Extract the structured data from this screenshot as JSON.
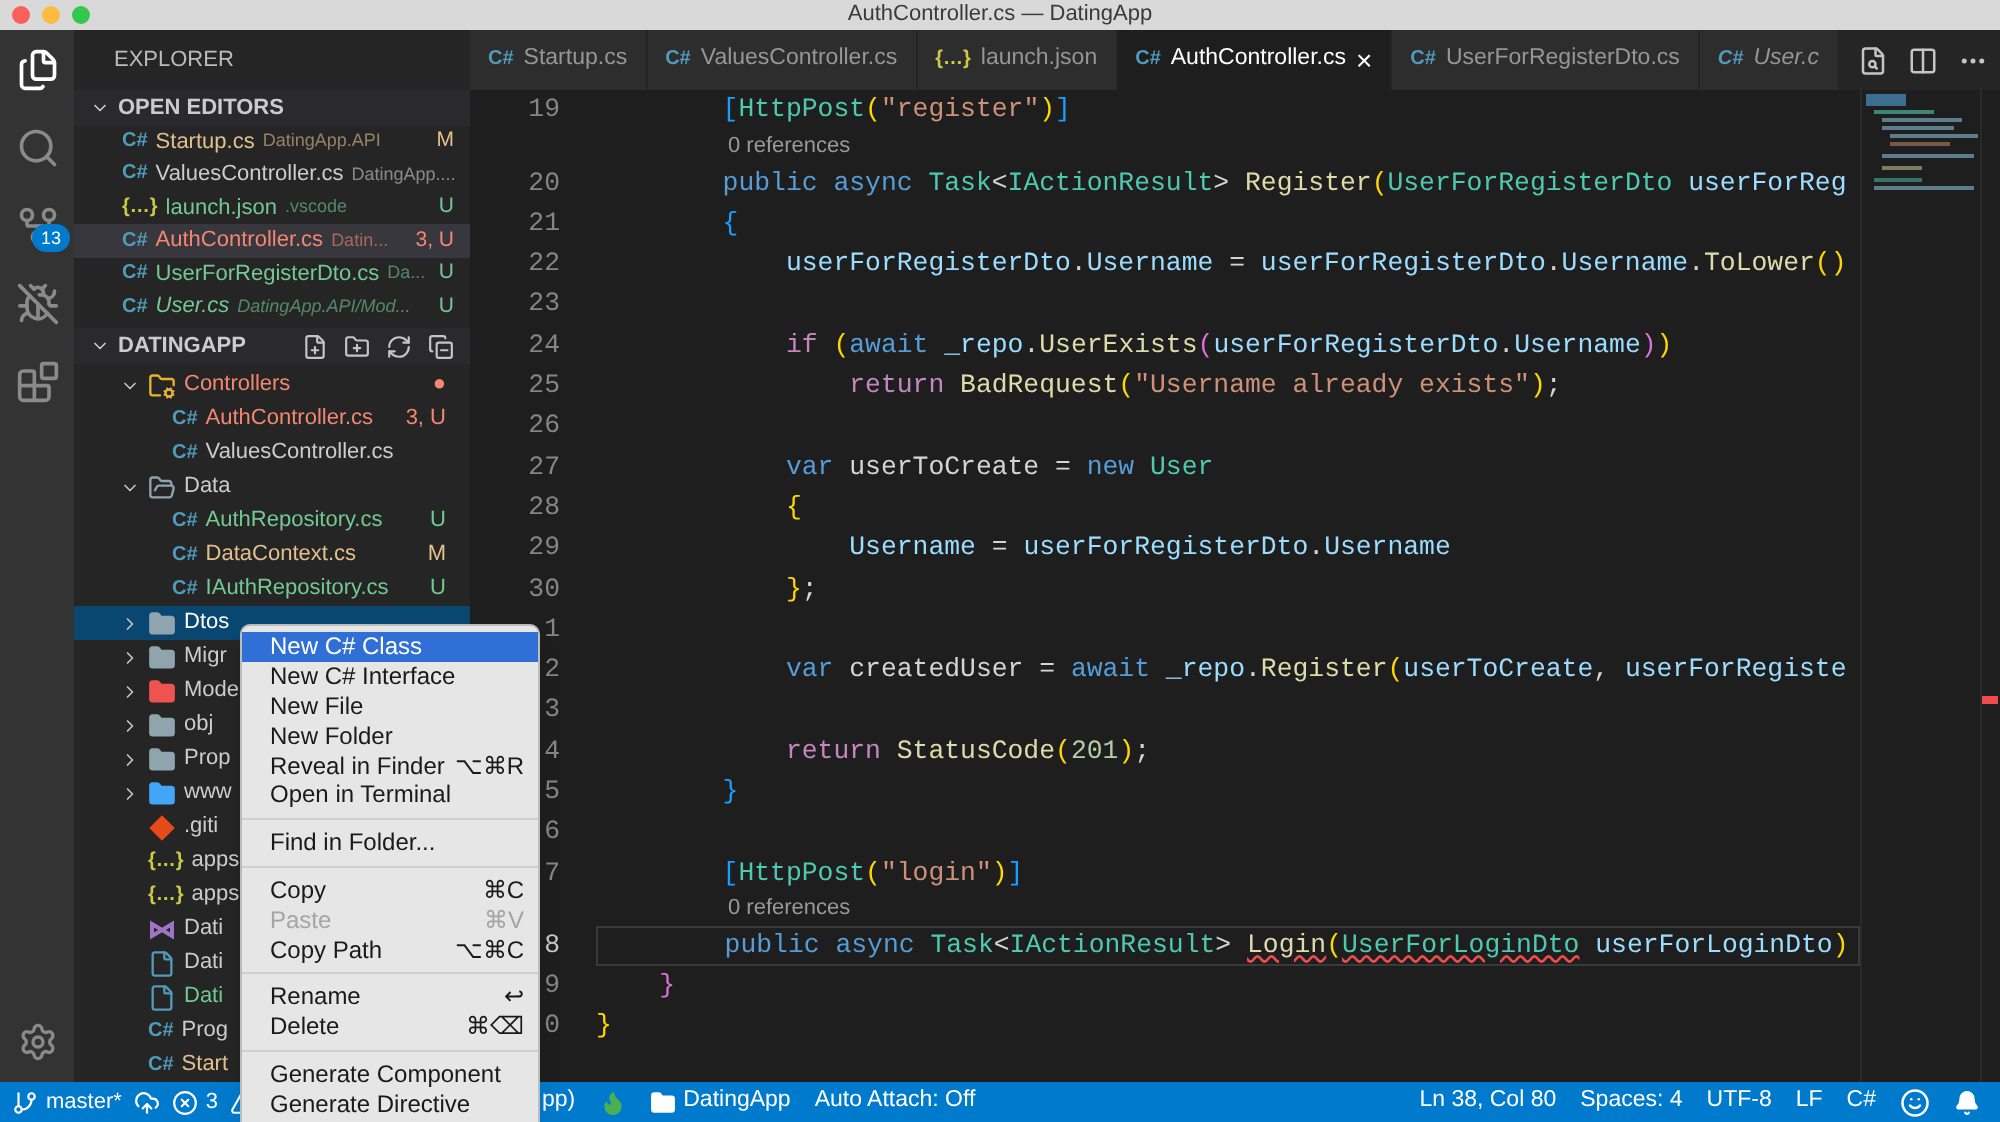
{
  "window": {
    "title": "AuthController.cs — DatingApp"
  },
  "activity_bar": {
    "items": [
      {
        "kind": "explorer",
        "selected": true
      },
      {
        "kind": "search",
        "selected": false
      },
      {
        "kind": "scm",
        "selected": false,
        "badge": "13"
      },
      {
        "kind": "debug",
        "selected": false
      },
      {
        "kind": "extensions",
        "selected": false
      }
    ]
  },
  "sidebar": {
    "title": "EXPLORER",
    "open_editors": {
      "title": "OPEN EDITORS",
      "expanded": true,
      "items": [
        {
          "name": "Startup.cs",
          "description": "DatingApp.API",
          "badge": "M",
          "kind": "csharp",
          "glyph": "C#",
          "color": "#e2c08d",
          "selected": false,
          "preview": false
        },
        {
          "name": "ValuesController.cs",
          "description": "DatingApp....",
          "kind": "csharp",
          "glyph": "C#",
          "color": "#cccccc",
          "selected": false,
          "preview": false
        },
        {
          "name": "launch.json",
          "description": ".vscode",
          "badge": "U",
          "kind": "json",
          "glyph": "{…}",
          "color": "#73c991",
          "selected": false,
          "preview": false
        },
        {
          "name": "AuthController.cs",
          "description": "Datin...",
          "badge": "3, U",
          "kind": "csharp",
          "glyph": "C#",
          "color": "#f48771",
          "selected": true,
          "preview": false
        },
        {
          "name": "UserForRegisterDto.cs",
          "description": "Da...",
          "badge": "U",
          "kind": "csharp",
          "glyph": "C#",
          "color": "#73c991",
          "selected": false,
          "preview": false
        },
        {
          "name": "User.cs",
          "description": "DatingApp.API/Mod...",
          "badge": "U",
          "kind": "csharp",
          "glyph": "C#",
          "color": "#73c991",
          "selected": false,
          "preview": true
        }
      ]
    },
    "project": {
      "title": "DATINGAPP",
      "expanded": true,
      "tree": [
        {
          "name": "Controllers",
          "kind": "folder-gear",
          "color": "#f48771",
          "badge": "●",
          "expanded": true,
          "selected": false,
          "children": [
            {
              "name": "AuthController.cs",
              "kind": "csharp",
              "glyph": "C#",
              "color": "#f48771",
              "badge": "3, U",
              "selected": false
            },
            {
              "name": "ValuesController.cs",
              "kind": "csharp",
              "glyph": "C#",
              "color": "#cccccc",
              "selected": false
            }
          ]
        },
        {
          "name": "Data",
          "kind": "folder-open",
          "color": "#cccccc",
          "expanded": true,
          "selected": false,
          "children": [
            {
              "name": "AuthRepository.cs",
              "kind": "csharp",
              "glyph": "C#",
              "color": "#73c991",
              "badge": "U",
              "selected": false
            },
            {
              "name": "DataContext.cs",
              "kind": "csharp",
              "glyph": "C#",
              "color": "#e2c08d",
              "badge": "M",
              "selected": false
            },
            {
              "name": "IAuthRepository.cs",
              "kind": "csharp",
              "glyph": "C#",
              "color": "#73c991",
              "badge": "U",
              "selected": false
            }
          ]
        },
        {
          "name": "Dtos",
          "kind": "folder",
          "expanded": false,
          "selected": true
        },
        {
          "name": "Migr",
          "kind": "folder",
          "color": "#cccccc",
          "expanded": false,
          "selected": false
        },
        {
          "name": "Mode",
          "kind": "folder-red",
          "color": "#cccccc",
          "expanded": false,
          "selected": false
        },
        {
          "name": "obj",
          "kind": "folder",
          "color": "#cccccc",
          "expanded": false,
          "selected": false
        },
        {
          "name": "Prop",
          "kind": "folder",
          "color": "#cccccc",
          "expanded": false,
          "selected": false
        },
        {
          "name": "www",
          "kind": "folder-web",
          "color": "#cccccc",
          "expanded": false,
          "selected": false
        },
        {
          "name": ".giti",
          "kind": "git",
          "color": "#cccccc",
          "selected": false
        },
        {
          "name": "apps",
          "kind": "json",
          "glyph": "{…}",
          "color": "#cccccc",
          "selected": false
        },
        {
          "name": "apps",
          "kind": "json",
          "glyph": "{…}",
          "color": "#cccccc",
          "selected": false
        },
        {
          "name": "Dati",
          "kind": "vs",
          "color": "#cccccc",
          "selected": false
        },
        {
          "name": "Dati",
          "kind": "file",
          "color": "#cccccc",
          "selected": false
        },
        {
          "name": "Dati",
          "kind": "file",
          "color": "#73c991",
          "selected": false
        },
        {
          "name": "Prog",
          "kind": "csharp",
          "glyph": "C#",
          "color": "#cccccc",
          "selected": false
        },
        {
          "name": "Start",
          "kind": "csharp",
          "glyph": "C#",
          "color": "#e2c08d",
          "selected": false
        }
      ]
    }
  },
  "tabs": [
    {
      "label": "Startup.cs",
      "kind": "csharp",
      "glyph": "C#",
      "selected": false,
      "preview": false
    },
    {
      "label": "ValuesController.cs",
      "kind": "csharp",
      "glyph": "C#",
      "selected": false,
      "preview": false
    },
    {
      "label": "launch.json",
      "kind": "json",
      "glyph": "{…}",
      "selected": false,
      "preview": false
    },
    {
      "label": "AuthController.cs",
      "kind": "csharp",
      "glyph": "C#",
      "selected": true,
      "preview": false,
      "close": "×"
    },
    {
      "label": "UserForRegisterDto.cs",
      "kind": "csharp",
      "glyph": "C#",
      "selected": false,
      "preview": false
    },
    {
      "label": "User.c",
      "kind": "csharp",
      "glyph": "C#",
      "selected": false,
      "preview": true
    }
  ],
  "editor": {
    "lines": [
      {
        "kind": "code",
        "number": "19",
        "current": false,
        "tokens": [
          {
            "text": "        [",
            "kind": "b3"
          },
          {
            "text": "HttpPost",
            "kind": "type"
          },
          {
            "text": "(",
            "kind": "b1"
          },
          {
            "text": "\"register\"",
            "kind": "str"
          },
          {
            "text": ")",
            "kind": "b1"
          },
          {
            "text": "]",
            "kind": "b3"
          }
        ]
      },
      {
        "kind": "codelens",
        "text": "0 references"
      },
      {
        "kind": "code",
        "number": "20",
        "current": false,
        "tokens": [
          {
            "text": "        public async ",
            "kind": "kw"
          },
          {
            "text": "Task",
            "kind": "type"
          },
          {
            "text": "<",
            "kind": "p"
          },
          {
            "text": "IActionResult",
            "kind": "type"
          },
          {
            "text": "> ",
            "kind": "p"
          },
          {
            "text": "Register",
            "kind": "fn"
          },
          {
            "text": "(",
            "kind": "b1"
          },
          {
            "text": "UserForRegisterDto ",
            "kind": "type"
          },
          {
            "text": "userForReg",
            "kind": "var"
          }
        ]
      },
      {
        "kind": "code",
        "number": "21",
        "current": false,
        "tokens": [
          {
            "text": "        {",
            "kind": "b3"
          }
        ]
      },
      {
        "kind": "code",
        "number": "22",
        "current": false,
        "tokens": [
          {
            "text": "            userForRegisterDto",
            "kind": "var"
          },
          {
            "text": ".",
            "kind": "p"
          },
          {
            "text": "Username",
            "kind": "var"
          },
          {
            "text": " = ",
            "kind": "p"
          },
          {
            "text": "userForRegisterDto",
            "kind": "var"
          },
          {
            "text": ".",
            "kind": "p"
          },
          {
            "text": "Username",
            "kind": "var"
          },
          {
            "text": ".",
            "kind": "p"
          },
          {
            "text": "ToLower",
            "kind": "fn"
          },
          {
            "text": "()",
            "kind": "b1"
          }
        ]
      },
      {
        "kind": "code",
        "number": "23",
        "current": false
      },
      {
        "kind": "code",
        "number": "24",
        "current": false,
        "tokens": [
          {
            "text": "            if ",
            "kind": "ctl"
          },
          {
            "text": "(",
            "kind": "b1"
          },
          {
            "text": "await ",
            "kind": "kw"
          },
          {
            "text": "_repo",
            "kind": "var"
          },
          {
            "text": ".",
            "kind": "p"
          },
          {
            "text": "UserExists",
            "kind": "fn"
          },
          {
            "text": "(",
            "kind": "b2"
          },
          {
            "text": "userForRegisterDto",
            "kind": "var"
          },
          {
            "text": ".",
            "kind": "p"
          },
          {
            "text": "Username",
            "kind": "var"
          },
          {
            "text": ")",
            "kind": "b2"
          },
          {
            "text": ")",
            "kind": "b1"
          }
        ]
      },
      {
        "kind": "code",
        "number": "25",
        "current": false,
        "tokens": [
          {
            "text": "                return ",
            "kind": "ctl"
          },
          {
            "text": "BadRequest",
            "kind": "fn"
          },
          {
            "text": "(",
            "kind": "b1"
          },
          {
            "text": "\"Username already exists\"",
            "kind": "str"
          },
          {
            "text": ")",
            "kind": "b1"
          },
          {
            "text": ";",
            "kind": "p"
          }
        ]
      },
      {
        "kind": "code",
        "number": "26",
        "current": false
      },
      {
        "kind": "code",
        "number": "27",
        "current": false,
        "tokens": [
          {
            "text": "            var",
            "kind": "kw"
          },
          {
            "text": " userToCreate = ",
            "kind": "p"
          },
          {
            "text": "new ",
            "kind": "kw"
          },
          {
            "text": "User",
            "kind": "type"
          }
        ]
      },
      {
        "kind": "code",
        "number": "28",
        "current": false,
        "tokens": [
          {
            "text": "            {",
            "kind": "b1"
          }
        ]
      },
      {
        "kind": "code",
        "number": "29",
        "current": false,
        "tokens": [
          {
            "text": "                Username",
            "kind": "var"
          },
          {
            "text": " = ",
            "kind": "p"
          },
          {
            "text": "userForRegisterDto",
            "kind": "var"
          },
          {
            "text": ".",
            "kind": "p"
          },
          {
            "text": "Username",
            "kind": "var"
          }
        ]
      },
      {
        "kind": "code",
        "number": "30",
        "current": false,
        "tokens": [
          {
            "text": "            }",
            "kind": "b1"
          },
          {
            "text": ";",
            "kind": "p"
          }
        ]
      },
      {
        "kind": "code",
        "number": "1",
        "current": false
      },
      {
        "kind": "code",
        "number": "2",
        "current": false,
        "tokens": [
          {
            "text": "            var",
            "kind": "kw"
          },
          {
            "text": " createdUser = ",
            "kind": "p"
          },
          {
            "text": "await ",
            "kind": "kw"
          },
          {
            "text": "_repo",
            "kind": "var"
          },
          {
            "text": ".",
            "kind": "p"
          },
          {
            "text": "Register",
            "kind": "fn"
          },
          {
            "text": "(",
            "kind": "b1"
          },
          {
            "text": "userToCreate",
            "kind": "var"
          },
          {
            "text": ", ",
            "kind": "p"
          },
          {
            "text": "userForRegiste",
            "kind": "var"
          }
        ]
      },
      {
        "kind": "code",
        "number": "3",
        "current": false
      },
      {
        "kind": "code",
        "number": "4",
        "current": false,
        "tokens": [
          {
            "text": "            return ",
            "kind": "ctl"
          },
          {
            "text": "StatusCode",
            "kind": "fn"
          },
          {
            "text": "(",
            "kind": "b1"
          },
          {
            "text": "201",
            "kind": "num"
          },
          {
            "text": ")",
            "kind": "b1"
          },
          {
            "text": ";",
            "kind": "p"
          }
        ]
      },
      {
        "kind": "code",
        "number": "5",
        "current": false,
        "tokens": [
          {
            "text": "        }",
            "kind": "b3"
          }
        ]
      },
      {
        "kind": "code",
        "number": "6",
        "current": false
      },
      {
        "kind": "code",
        "number": "7",
        "current": false,
        "tokens": [
          {
            "text": "        [",
            "kind": "b3"
          },
          {
            "text": "HttpPost",
            "kind": "type"
          },
          {
            "text": "(",
            "kind": "b1"
          },
          {
            "text": "\"login\"",
            "kind": "str"
          },
          {
            "text": ")",
            "kind": "b1"
          },
          {
            "text": "]",
            "kind": "b3"
          }
        ]
      },
      {
        "kind": "codelens",
        "text": "0 references"
      },
      {
        "kind": "code",
        "number": "8",
        "current": true,
        "tokens": [
          {
            "text": "        public async ",
            "kind": "kw"
          },
          {
            "text": "Task",
            "kind": "type"
          },
          {
            "text": "<",
            "kind": "p"
          },
          {
            "text": "IActionResult",
            "kind": "type"
          },
          {
            "text": "> ",
            "kind": "p"
          },
          {
            "text": "Login",
            "kind": "fnerr"
          },
          {
            "text": "(",
            "kind": "b1"
          },
          {
            "text": "UserForLoginDto",
            "kind": "typeerr"
          },
          {
            "text": " userForLoginDto",
            "kind": "var"
          },
          {
            "text": ")",
            "kind": "b1"
          }
        ]
      },
      {
        "kind": "code",
        "number": "9",
        "current": false,
        "tokens": [
          {
            "text": "    }",
            "kind": "b2"
          }
        ]
      },
      {
        "kind": "code",
        "number": "0",
        "current": false,
        "tokens": [
          {
            "text": "}",
            "kind": "b1"
          }
        ]
      }
    ]
  },
  "context_menu": {
    "items": [
      {
        "kind": "item",
        "label": "New C# Class",
        "selected": true,
        "disabled": false
      },
      {
        "kind": "item",
        "label": "New C# Interface",
        "selected": false,
        "disabled": false
      },
      {
        "kind": "item",
        "label": "New File",
        "selected": false,
        "disabled": false
      },
      {
        "kind": "item",
        "label": "New Folder",
        "selected": false,
        "disabled": false
      },
      {
        "kind": "item",
        "label": "Reveal in Finder",
        "shortcut": "⌥⌘R",
        "selected": false,
        "disabled": false
      },
      {
        "kind": "item",
        "label": "Open in Terminal",
        "selected": false,
        "disabled": false
      },
      {
        "kind": "separator"
      },
      {
        "kind": "item",
        "label": "Find in Folder...",
        "selected": false,
        "disabled": false
      },
      {
        "kind": "separator"
      },
      {
        "kind": "item",
        "label": "Copy",
        "shortcut": "⌘C",
        "selected": false,
        "disabled": false
      },
      {
        "kind": "item",
        "label": "Paste",
        "shortcut": "⌘V",
        "selected": false,
        "disabled": true
      },
      {
        "kind": "item",
        "label": "Copy Path",
        "shortcut": "⌥⌘C",
        "selected": false,
        "disabled": false
      },
      {
        "kind": "separator"
      },
      {
        "kind": "item",
        "label": "Rename",
        "shortcut": "↩",
        "selected": false,
        "disabled": false
      },
      {
        "kind": "item",
        "label": "Delete",
        "shortcut": "⌘⌫",
        "selected": false,
        "disabled": false
      },
      {
        "kind": "separator"
      },
      {
        "kind": "item",
        "label": "Generate Component",
        "selected": false,
        "disabled": false
      },
      {
        "kind": "item",
        "label": "Generate Directive",
        "selected": false,
        "disabled": false
      }
    ]
  },
  "status_bar": {
    "left": [
      {
        "kind": "branch",
        "text": "master*"
      },
      {
        "kind": "sync"
      },
      {
        "kind": "errors",
        "text": "3"
      },
      {
        "kind": "warnings"
      }
    ],
    "middle": [
      {
        "kind": "text",
        "text": "pp)"
      },
      {
        "kind": "flame"
      },
      {
        "kind": "folder",
        "text": "DatingApp"
      },
      {
        "kind": "text",
        "text": "Auto Attach: Off"
      }
    ],
    "right": [
      {
        "kind": "text",
        "text": "Ln 38, Col 80"
      },
      {
        "kind": "text",
        "text": "Spaces: 4"
      },
      {
        "kind": "text",
        "text": "UTF-8"
      },
      {
        "kind": "text",
        "text": "LF"
      },
      {
        "kind": "text",
        "text": "C#"
      },
      {
        "kind": "feedback"
      },
      {
        "kind": "bell"
      }
    ]
  }
}
